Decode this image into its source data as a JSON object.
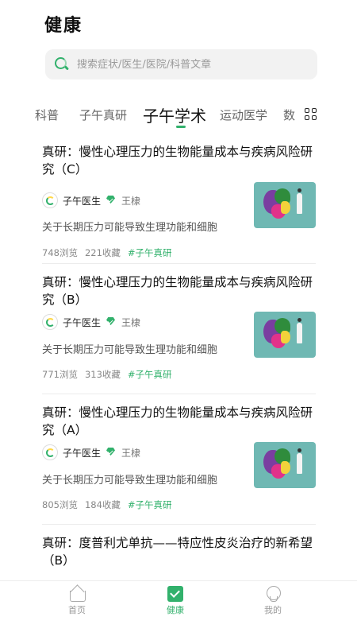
{
  "header": {
    "title": "健康"
  },
  "search": {
    "placeholder": "搜索症状/医生/医院/科普文章"
  },
  "tabs": [
    {
      "label": "科普"
    },
    {
      "label": "子午真研"
    },
    {
      "label": "子午学术",
      "active": true
    },
    {
      "label": "运动医学"
    },
    {
      "label": "数"
    }
  ],
  "articles": [
    {
      "title": "真研：慢性心理压力的生物能量成本与疾病风险研究（C）",
      "author": "子午医生",
      "doctor": "王棣",
      "summary": "关于长期压力可能导致生理功能和细胞",
      "views": "748浏览",
      "favorites": "221收藏",
      "tag": "#子午真研"
    },
    {
      "title": "真研：慢性心理压力的生物能量成本与疾病风险研究（B）",
      "author": "子午医生",
      "doctor": "王棣",
      "summary": "关于长期压力可能导致生理功能和细胞",
      "views": "771浏览",
      "favorites": "313收藏",
      "tag": "#子午真研"
    },
    {
      "title": "真研：慢性心理压力的生物能量成本与疾病风险研究（A）",
      "author": "子午医生",
      "doctor": "王棣",
      "summary": "关于长期压力可能导致生理功能和细胞",
      "views": "805浏览",
      "favorites": "184收藏",
      "tag": "#子午真研"
    },
    {
      "title": "真研：度普利尤单抗——特应性皮炎治疗的新希望（B）"
    }
  ],
  "bottom_nav": [
    {
      "label": "首页",
      "icon": "home-icon"
    },
    {
      "label": "健康",
      "icon": "health-icon",
      "active": true
    },
    {
      "label": "我的",
      "icon": "profile-icon"
    }
  ],
  "colors": {
    "accent": "#32b16c",
    "thumbnail_bg": "#6fb8b3"
  }
}
